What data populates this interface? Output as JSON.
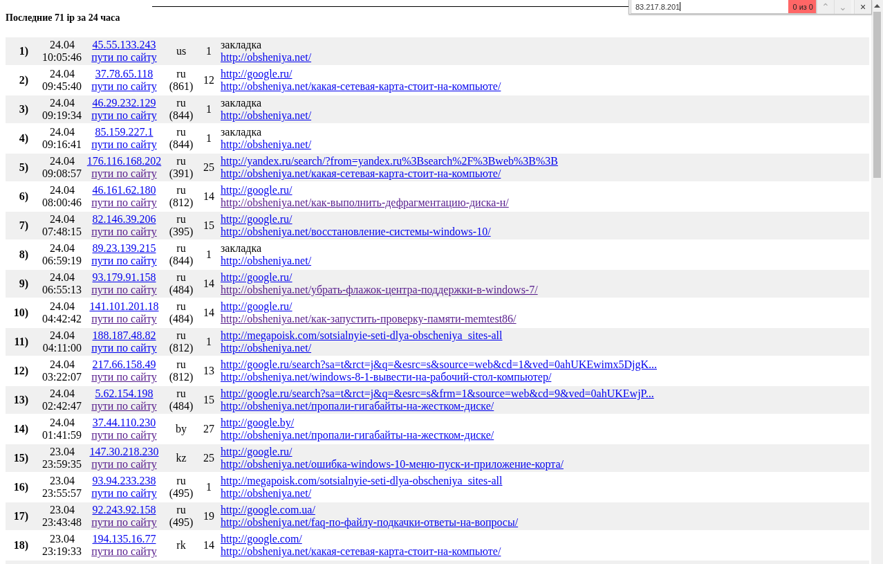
{
  "find_bar": {
    "value": "83.217.8.201",
    "result": "0 из 0",
    "up": "⌃",
    "down": "⌄",
    "close": "×"
  },
  "title": "Последние 71 ip за 24 часа",
  "rows": [
    {
      "num": "1)",
      "date": "24.04",
      "time": "10:05:46",
      "ip": "45.55.133.243",
      "paths": "пути по сайту",
      "paths_visited": false,
      "country": "us",
      "code": "",
      "count": "1",
      "source": {
        "kind": "text",
        "text": "закладка"
      },
      "page": {
        "text": "http://obsheniya.net/",
        "visited": false
      }
    },
    {
      "num": "2)",
      "date": "24.04",
      "time": "09:45:40",
      "ip": "37.78.65.118",
      "paths": "пути по сайту",
      "paths_visited": false,
      "country": "ru",
      "code": "(861)",
      "count": "12",
      "source": {
        "kind": "link",
        "text": "http://google.ru/",
        "visited": false
      },
      "page": {
        "text": "http://obsheniya.net/какая-сетевая-карта-стоит-на-компьюте/",
        "visited": false
      }
    },
    {
      "num": "3)",
      "date": "24.04",
      "time": "09:19:34",
      "ip": "46.29.232.129",
      "paths": "пути по сайту",
      "paths_visited": false,
      "country": "ru",
      "code": "(844)",
      "count": "1",
      "source": {
        "kind": "text",
        "text": "закладка"
      },
      "page": {
        "text": "http://obsheniya.net/",
        "visited": false
      }
    },
    {
      "num": "4)",
      "date": "24.04",
      "time": "09:16:41",
      "ip": "85.159.227.1",
      "paths": "пути по сайту",
      "paths_visited": false,
      "country": "ru",
      "code": "(844)",
      "count": "1",
      "source": {
        "kind": "text",
        "text": "закладка"
      },
      "page": {
        "text": "http://obsheniya.net/",
        "visited": false
      }
    },
    {
      "num": "5)",
      "date": "24.04",
      "time": "09:08:57",
      "ip": "176.116.168.202",
      "paths": "пути по сайту",
      "paths_visited": true,
      "country": "ru",
      "code": "(391)",
      "count": "25",
      "source": {
        "kind": "link",
        "text": "http://yandex.ru/search/?from=yandex.ru%3Bsearch%2F%3Bweb%3B%3B",
        "visited": false
      },
      "page": {
        "text": "http://obsheniya.net/какая-сетевая-карта-стоит-на-компьюте/",
        "visited": false
      }
    },
    {
      "num": "6)",
      "date": "24.04",
      "time": "08:00:46",
      "ip": "46.161.62.180",
      "paths": "пути по сайту",
      "paths_visited": true,
      "country": "ru",
      "code": "(812)",
      "count": "14",
      "source": {
        "kind": "link",
        "text": "http://google.ru/",
        "visited": false
      },
      "page": {
        "text": "http://obsheniya.net/как-выполнить-дефрагментацию-диска-н/",
        "visited": true
      }
    },
    {
      "num": "7)",
      "date": "24.04",
      "time": "07:48:15",
      "ip": "82.146.39.206",
      "paths": "пути по сайту",
      "paths_visited": true,
      "country": "ru",
      "code": "(395)",
      "count": "15",
      "source": {
        "kind": "link",
        "text": "http://google.ru/",
        "visited": false
      },
      "page": {
        "text": "http://obsheniya.net/восстановление-системы-windows-10/",
        "visited": false
      }
    },
    {
      "num": "8)",
      "date": "24.04",
      "time": "06:59:19",
      "ip": "89.23.139.215",
      "paths": "пути по сайту",
      "paths_visited": false,
      "country": "ru",
      "code": "(844)",
      "count": "1",
      "source": {
        "kind": "text",
        "text": "закладка"
      },
      "page": {
        "text": "http://obsheniya.net/",
        "visited": false
      }
    },
    {
      "num": "9)",
      "date": "24.04",
      "time": "06:55:13",
      "ip": "93.179.91.158",
      "paths": "пути по сайту",
      "paths_visited": true,
      "country": "ru",
      "code": "(484)",
      "count": "14",
      "source": {
        "kind": "link",
        "text": "http://google.ru/",
        "visited": false
      },
      "page": {
        "text": "http://obsheniya.net/убрать-флажок-центра-поддержки-в-windows-7/",
        "visited": true
      }
    },
    {
      "num": "10)",
      "date": "24.04",
      "time": "04:42:42",
      "ip": "141.101.201.18",
      "paths": "пути по сайту",
      "paths_visited": true,
      "country": "ru",
      "code": "(484)",
      "count": "14",
      "source": {
        "kind": "link",
        "text": "http://google.ru/",
        "visited": false
      },
      "page": {
        "text": "http://obsheniya.net/как-запустить-проверку-памяти-memtest86/",
        "visited": true
      }
    },
    {
      "num": "11)",
      "date": "24.04",
      "time": "04:11:00",
      "ip": "188.187.48.82",
      "paths": "пути по сайту",
      "paths_visited": false,
      "country": "ru",
      "code": "(812)",
      "count": "1",
      "source": {
        "kind": "link",
        "text": "http://megapoisk.com/sotsialnyie-seti-dlya-obscheniya_sites-all",
        "visited": false
      },
      "page": {
        "text": "http://obsheniya.net/",
        "visited": false
      }
    },
    {
      "num": "12)",
      "date": "24.04",
      "time": "03:22:07",
      "ip": "217.66.158.49",
      "paths": "пути по сайту",
      "paths_visited": true,
      "country": "ru",
      "code": "(812)",
      "count": "13",
      "source": {
        "kind": "link",
        "text": "http://google.ru/search?sa=t&rct=j&q=&esrc=s&source=web&cd=1&ved=0ahUKEwimx5DjgK...",
        "visited": false
      },
      "page": {
        "text": "http://obsheniya.net/windows-8-1-вывести-на-рабочий-стол-компьютер/",
        "visited": false
      }
    },
    {
      "num": "13)",
      "date": "24.04",
      "time": "02:42:47",
      "ip": "5.62.154.198",
      "paths": "пути по сайту",
      "paths_visited": true,
      "country": "ru",
      "code": "(484)",
      "count": "15",
      "source": {
        "kind": "link",
        "text": "http://google.ru/search?sa=t&rct=j&q=&esrc=s&frm=1&source=web&cd=9&ved=0ahUKEwjP...",
        "visited": false
      },
      "page": {
        "text": "http://obsheniya.net/пропали-гигабайты-на-жестком-диске/",
        "visited": false
      }
    },
    {
      "num": "14)",
      "date": "24.04",
      "time": "01:41:59",
      "ip": "37.44.110.230",
      "paths": "пути по сайту",
      "paths_visited": true,
      "country": "by",
      "code": "",
      "count": "27",
      "source": {
        "kind": "link",
        "text": "http://google.by/",
        "visited": false
      },
      "page": {
        "text": "http://obsheniya.net/пропали-гигабайты-на-жестком-диске/",
        "visited": false
      }
    },
    {
      "num": "15)",
      "date": "23.04",
      "time": "23:59:35",
      "ip": "147.30.218.230",
      "paths": "пути по сайту",
      "paths_visited": true,
      "country": "kz",
      "code": "",
      "count": "25",
      "source": {
        "kind": "link",
        "text": "http://google.ru/",
        "visited": false
      },
      "page": {
        "text": "http://obsheniya.net/ошибка-windows-10-меню-пуск-и-приложение-корта/",
        "visited": false
      }
    },
    {
      "num": "16)",
      "date": "23.04",
      "time": "23:55:57",
      "ip": "93.94.233.238",
      "paths": "пути по сайту",
      "paths_visited": false,
      "country": "ru",
      "code": "(495)",
      "count": "1",
      "source": {
        "kind": "link",
        "text": "http://megapoisk.com/sotsialnyie-seti-dlya-obscheniya_sites-all",
        "visited": false
      },
      "page": {
        "text": "http://obsheniya.net/",
        "visited": false
      }
    },
    {
      "num": "17)",
      "date": "23.04",
      "time": "23:43:48",
      "ip": "92.243.92.158",
      "paths": "пути по сайту",
      "paths_visited": true,
      "country": "ru",
      "code": "(495)",
      "count": "19",
      "source": {
        "kind": "link",
        "text": "http://google.com.ua/",
        "visited": false
      },
      "page": {
        "text": "http://obsheniya.net/faq-по-файлу-подкачки-ответы-на-вопросы/",
        "visited": false
      }
    },
    {
      "num": "18)",
      "date": "23.04",
      "time": "23:19:33",
      "ip": "194.135.16.77",
      "paths": "пути по сайту",
      "paths_visited": true,
      "country": "rk",
      "code": "",
      "count": "14",
      "source": {
        "kind": "link",
        "text": "http://google.com/",
        "visited": false
      },
      "page": {
        "text": "http://obsheniya.net/какая-сетевая-карта-стоит-на-компьюте/",
        "visited": false
      }
    }
  ]
}
